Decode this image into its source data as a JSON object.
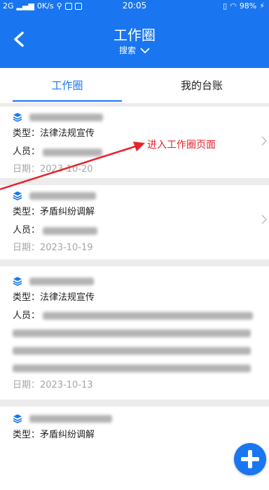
{
  "status_bar": {
    "network": "2G",
    "speed": "0K/s",
    "time": "20:05",
    "battery": "98%"
  },
  "header": {
    "title": "工作圈",
    "search_label": "搜索"
  },
  "tabs": [
    {
      "label": "工作圈",
      "active": true
    },
    {
      "label": "我的台账",
      "active": false
    }
  ],
  "annotation": {
    "text": "进入工作圈页面",
    "color": "#e8232c"
  },
  "cards": [
    {
      "type_label": "类型：法律法规宣传",
      "person_label": "人员：",
      "date_label": "日期：2023-10-20"
    },
    {
      "type_label": "类型：矛盾纠纷调解",
      "person_label": "人员：",
      "date_label": "日期：2023-10-19"
    },
    {
      "type_label": "类型：法律法规宣传",
      "person_label": "人员：",
      "date_label": "日期：2023-10-13"
    },
    {
      "type_label": "类型：矛盾纠纷调解"
    }
  ],
  "colors": {
    "primary": "#1976f0",
    "background": "#ececec",
    "date_text": "#a6a6a6"
  },
  "icons": {
    "back": "chevron-left-icon",
    "dropdown": "chevron-down-icon",
    "card": "layers-icon",
    "fab": "plus-icon"
  }
}
